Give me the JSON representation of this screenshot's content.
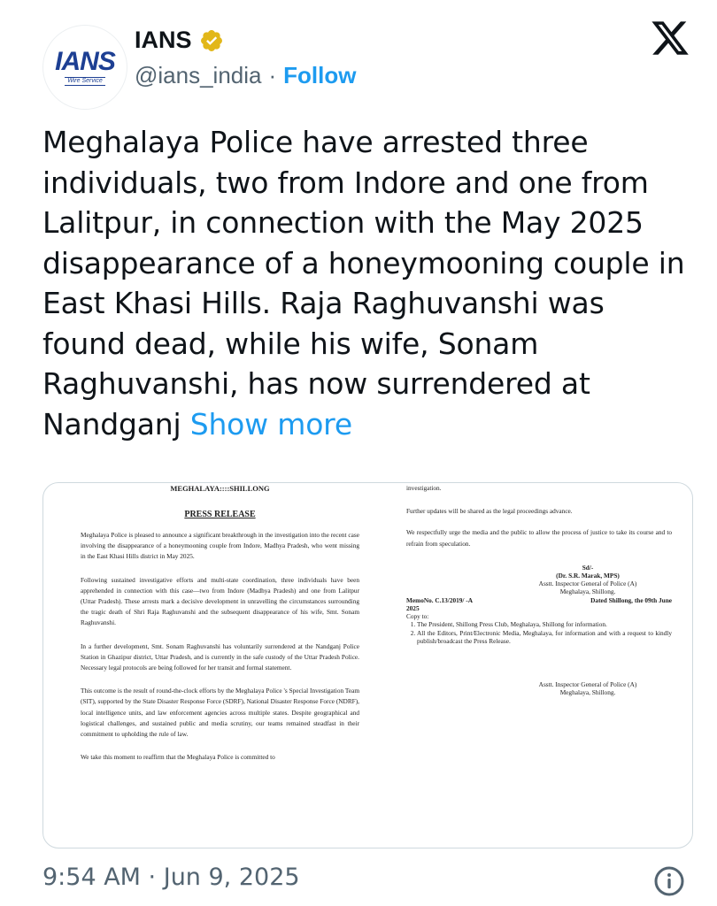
{
  "account": {
    "avatar_text": "IANS",
    "avatar_subtext": "Wire Service",
    "display_name": "IANS",
    "handle": "@ians_india",
    "separator": "·",
    "follow_label": "Follow",
    "verified_badge": "gold-verified-icon"
  },
  "tweet": {
    "text": "Meghalaya Police have arrested three individuals, two from Indore and one from Lalitpur, in connection with the May 2025 disappearance of a honeymooning couple in East Khasi Hills. Raja Raghuvanshi was found dead, while his wife, Sonam Raghuvanshi, has now surrendered at Nandganj ",
    "show_more": "Show more",
    "timestamp": "9:54 AM · Jun 9, 2025"
  },
  "document": {
    "header": "MEGHALAYA::::SHILLONG",
    "title": "PRESS RELEASE",
    "paragraphs": [
      "Meghalaya Police is pleased to announce a significant breakthrough in the investigation into the recent case involving the disappearance of a honeymooning couple from Indore, Madhya Pradesh, who went missing in the East Khasi Hills district in May 2025.",
      "Following sustained investigative efforts and multi-state coordination, three individuals have been apprehended in connection with this case—two from Indore (Madhya Pradesh) and one from Lalitpur (Uttar Pradesh). These arrests mark a decisive development in unravelling the circumstances surrounding the tragic death of Shri Raja Raghuvanshi and the subsequent disappearance of his wife, Smt. Sonam Raghuvanshi.",
      "In a further development, Smt. Sonam Raghuvanshi has voluntarily surrendered at the Nandganj Police Station in Ghazipur district, Uttar Pradesh, and is currently in the safe custody of the Uttar Pradesh Police. Necessary legal protocols are being followed for her transit and formal statement.",
      "This outcome is the result of round-the-clock efforts by the Meghalaya Police 's Special Investigation Team (SIT), supported by the State Disaster Response Force (SDRF), National Disaster Response Force (NDRF), local intelligence units, and law enforcement agencies across multiple states. Despite geographical and logistical challenges, and sustained public and media scrutiny, our teams remained steadfast in their commitment to upholding the rule of law.",
      "We take this moment to reaffirm that the Meghalaya Police is committed to"
    ],
    "right_paragraphs": [
      "investigation.",
      "Further updates will be shared as the legal proceedings advance.",
      "We respectfully urge the media and the public to allow the process of justice to take its course and to refrain from speculation."
    ],
    "signature": [
      "Sd/-",
      "(Dr. S.R. Marak, MPS)",
      "Asstt. Inspector General of Police (A)",
      "Meghalaya, Shillong."
    ],
    "memo_no": "MemoNo. C.13/2019/ -A",
    "memo_year": "2025",
    "memo_dated": "Dated Shillong, the 09th June",
    "copy_to": "Copy to:",
    "copy_list": [
      "The President, Shillong Press Club, Meghalaya, Shillong for information.",
      "All the Editors, Print/Electronic Media, Meghalaya, for information and with a request to kindly publish/broadcast the Press Release."
    ],
    "footer_sig": [
      "Asstt. Inspector General of Police (A)",
      "Meghalaya, Shillong."
    ]
  },
  "colors": {
    "accent": "#1d9bf0",
    "text": "#0f1419",
    "secondary": "#536471",
    "verified_gold": "#e2b719"
  }
}
